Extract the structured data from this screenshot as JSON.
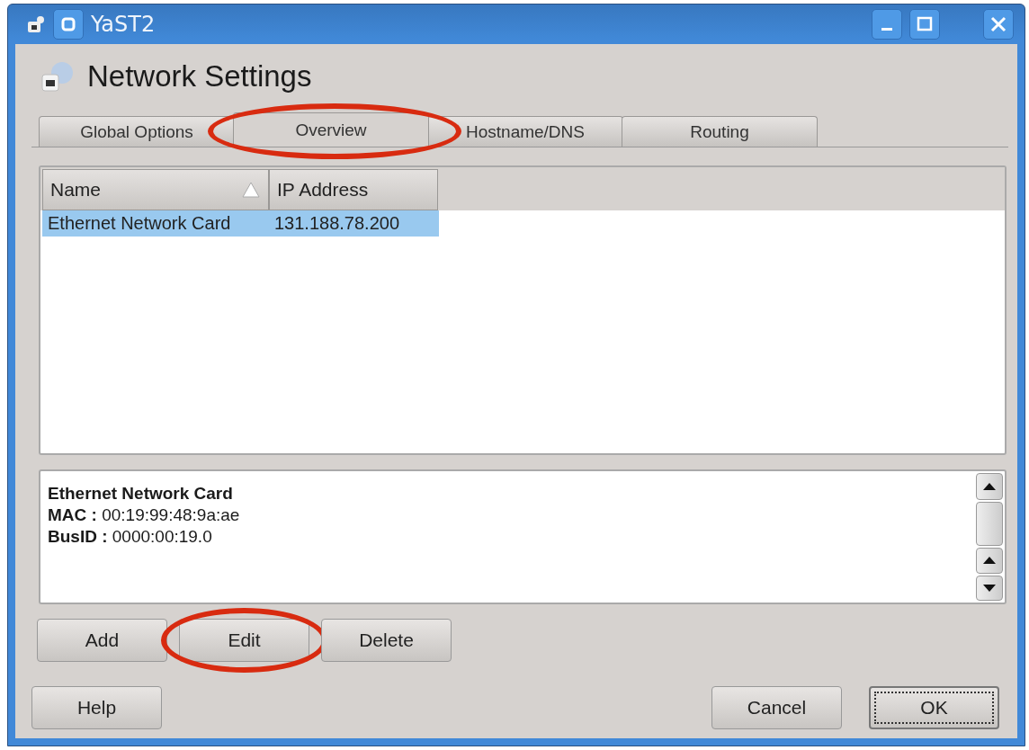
{
  "window": {
    "title": "YaST2"
  },
  "heading": "Network Settings",
  "tabs": [
    {
      "label": "Global Options",
      "selected": false,
      "circled": false
    },
    {
      "label": "Overview",
      "selected": true,
      "circled": true
    },
    {
      "label": "Hostname/DNS",
      "selected": false,
      "circled": false
    },
    {
      "label": "Routing",
      "selected": false,
      "circled": false
    }
  ],
  "table": {
    "columns": [
      {
        "label": "Name",
        "sorted": true
      },
      {
        "label": "IP Address",
        "sorted": false
      }
    ],
    "rows": [
      {
        "cells": [
          "Ethernet Network Card",
          "131.188.78.200"
        ],
        "selected": true
      }
    ]
  },
  "details": {
    "title": "Ethernet Network Card",
    "lines": [
      "**MAC :** 00:19:99:48:9a:ae",
      "**BusID :** 0000:00:19.0"
    ]
  },
  "actions": [
    {
      "label": "Add",
      "circled": false
    },
    {
      "label": "Edit",
      "circled": true
    },
    {
      "label": "Delete",
      "circled": false
    }
  ],
  "footer": {
    "left": [
      {
        "label": "Help",
        "default": false
      }
    ],
    "right": [
      {
        "label": "Cancel",
        "default": false
      },
      {
        "label": "OK",
        "default": true
      }
    ]
  }
}
